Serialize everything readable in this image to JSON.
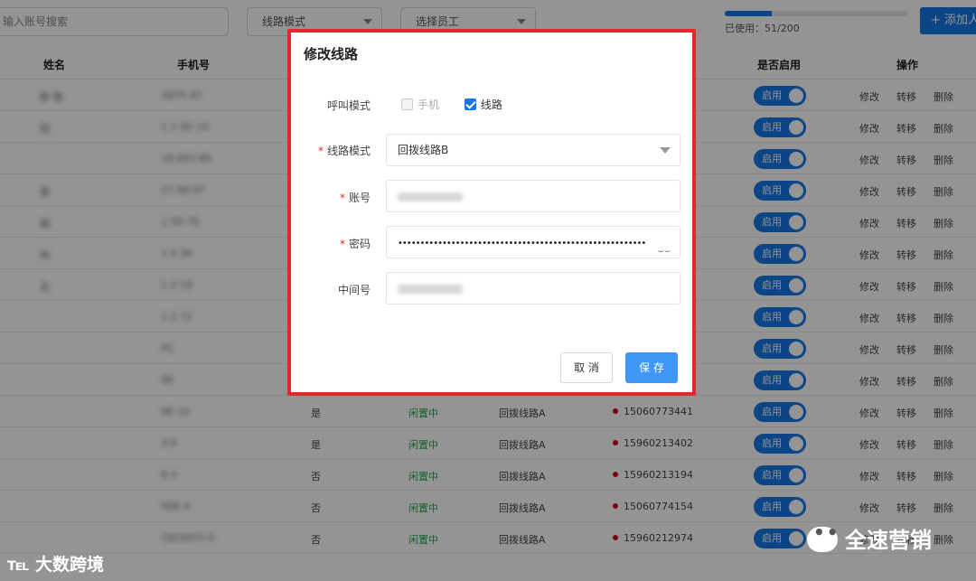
{
  "toolbar": {
    "search_placeholder": "输入账号搜索",
    "line_mode_select": "线路模式",
    "staff_select": "选择员工",
    "usage_text": "已使用：51/200",
    "usage_fraction": 0.255,
    "add_button": "添加人"
  },
  "table": {
    "headers": {
      "name": "姓名",
      "phone": "手机号",
      "enabled": "是否启用",
      "actions": "操作"
    },
    "rows": [
      {
        "name": "胖 萌",
        "phone": "1875  47",
        "extra": "",
        "status": "",
        "line": "",
        "number": ""
      },
      {
        "name": "  阳",
        "phone": "1 2  92 14",
        "extra": "",
        "status": "",
        "line": "",
        "number": ""
      },
      {
        "name": "  ",
        "phone": "19  003 60",
        "extra": "",
        "status": "",
        "line": "",
        "number": ""
      },
      {
        "name": "  蓉",
        "phone": "17  98 97",
        "extra": "",
        "status": "",
        "line": "",
        "number": ""
      },
      {
        "name": "  娟",
        "phone": "1  59 76",
        "extra": "",
        "status": "",
        "line": "",
        "number": ""
      },
      {
        "name": "  林",
        "phone": "1  0 30",
        "extra": "",
        "status": "",
        "line": "",
        "number": ""
      },
      {
        "name": "  龙",
        "phone": "1 2  19",
        "extra": "",
        "status": "",
        "line": "",
        "number": ""
      },
      {
        "name": "  ",
        "phone": "1 2  72",
        "extra": "",
        "status": "",
        "line": "",
        "number": ""
      },
      {
        "name": "  ",
        "phone": "  01",
        "extra": "",
        "status": "",
        "line": "",
        "number": ""
      },
      {
        "name": "  ",
        "phone": "  96",
        "extra": "",
        "status": "",
        "line": "",
        "number": ""
      },
      {
        "name": "  ",
        "phone": "88  10",
        "extra": "是",
        "status": "闲置中",
        "line": "回拨线路A",
        "number": "15060773441"
      },
      {
        "name": "  ",
        "phone": "3  9",
        "extra": "是",
        "status": "闲置中",
        "line": "回拨线路A",
        "number": "15960213402"
      },
      {
        "name": "  ",
        "phone": "8  3",
        "extra": "否",
        "status": "闲置中",
        "line": "回拨线路A",
        "number": "15960213194"
      },
      {
        "name": "  ",
        "phone": "506  4",
        "extra": "否",
        "status": "闲置中",
        "line": "回拨线路A",
        "number": "15060774154"
      },
      {
        "name": "  ",
        "phone": "1825973  6",
        "extra": "否",
        "status": "闲置中",
        "line": "回拨线路A",
        "number": "15960212974"
      }
    ],
    "toggle_label": "启用",
    "action_edit": "修改",
    "action_transfer": "转移",
    "action_delete": "删除"
  },
  "modal": {
    "title": "修改线路",
    "call_mode_label": "呼叫模式",
    "option_phone": "手机",
    "option_line": "线路",
    "option_phone_checked": false,
    "option_line_checked": true,
    "line_mode_label": "线路模式",
    "line_mode_value": "回拨线路B",
    "account_label": "账号",
    "password_label": "密码",
    "password_mask": "••••••••••••••••••••••••••••••••••••••••••••••••••••••••",
    "middle_number_label": "中间号",
    "cancel_button": "取 消",
    "save_button": "保 存"
  },
  "watermarks": {
    "left": "大数跨境",
    "right": "全速营销"
  },
  "colors": {
    "primary": "#1677e6",
    "highlight_border": "#e8262d",
    "idle_status": "#1fa84a"
  }
}
